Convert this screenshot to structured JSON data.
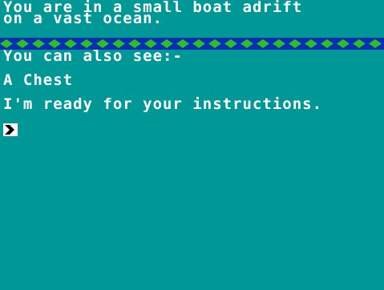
{
  "location": {
    "line1": "You are in a small boat adrift",
    "line2": "on a vast ocean."
  },
  "visible_items": {
    "heading": "You can also see:-",
    "items": [
      "A Chest"
    ]
  },
  "status": {
    "ready_message": "I'm ready for your instructions."
  },
  "colors": {
    "screen_background": "#009797",
    "text": "#ffffff",
    "divider_bar": "#0a2fb1",
    "divider_diamonds": "#2dbf23"
  },
  "icons": {
    "divider_pattern": "green-diamond-icon",
    "prompt": "command-prompt-icon"
  }
}
